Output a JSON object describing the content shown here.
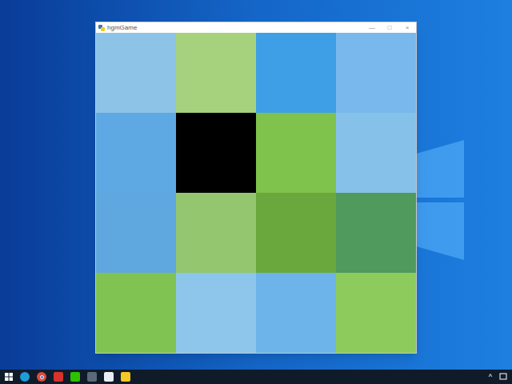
{
  "window": {
    "title": "hgmGame",
    "controls": [
      "—",
      "□",
      "×"
    ]
  },
  "puzzle": {
    "tiles": [
      {
        "empty": false,
        "color": "#8cc3e6"
      },
      {
        "empty": false,
        "color": "#a6d27e"
      },
      {
        "empty": false,
        "color": "#3e9fe6"
      },
      {
        "empty": false,
        "color": "#78b8ec"
      },
      {
        "empty": false,
        "color": "#5ea9e4"
      },
      {
        "empty": true,
        "color": "#000000"
      },
      {
        "empty": false,
        "color": "#7fc24c"
      },
      {
        "empty": false,
        "color": "#86c1ea"
      },
      {
        "empty": false,
        "color": "#5fa8df"
      },
      {
        "empty": false,
        "color": "#93c66e"
      },
      {
        "empty": false,
        "color": "#6aa83e"
      },
      {
        "empty": false,
        "color": "#4f9a5c"
      },
      {
        "empty": false,
        "color": "#80c352"
      },
      {
        "empty": false,
        "color": "#8ec5ea"
      },
      {
        "empty": false,
        "color": "#6cb4ea"
      },
      {
        "empty": false,
        "color": "#8dcb5c"
      }
    ]
  },
  "tray": {
    "chevron": "^"
  }
}
